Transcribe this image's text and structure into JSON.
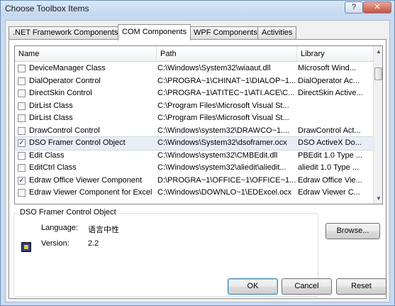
{
  "window": {
    "title": "Choose Toolbox Items",
    "help_label": "?",
    "close_label": "✕"
  },
  "tabs": [
    {
      "label": ".NET Framework Components",
      "active": false
    },
    {
      "label": "COM Components",
      "active": true
    },
    {
      "label": "WPF Components",
      "active": false
    },
    {
      "label": "Activities",
      "active": false
    }
  ],
  "list": {
    "columns": [
      "Name",
      "Path",
      "Library"
    ],
    "rows": [
      {
        "checked": false,
        "name": "DeviceManager Class",
        "path": "C:\\Windows\\System32\\wiaaut.dll",
        "library": "Microsoft Wind..."
      },
      {
        "checked": false,
        "name": "DialOperator Control",
        "path": "C:\\PROGRA~1\\CHINAT~1\\DIALOP~1...",
        "library": "DialOperator Ac..."
      },
      {
        "checked": false,
        "name": "DirectSkin Control",
        "path": "C:\\PROGRA~1\\ATITEC~1\\ATI.ACE\\C...",
        "library": "DirectSkin Active..."
      },
      {
        "checked": false,
        "name": "DirList Class",
        "path": "C:\\Program Files\\Microsoft Visual St...",
        "library": ""
      },
      {
        "checked": false,
        "name": "DirList Class",
        "path": "C:\\Program Files\\Microsoft Visual St...",
        "library": ""
      },
      {
        "checked": false,
        "name": "DrawControl Control",
        "path": "C:\\Windows\\system32\\DRAWCO~1....",
        "library": "DrawControl Act..."
      },
      {
        "checked": true,
        "name": "DSO Framer Control Object",
        "path": "C:\\Windows\\System32\\dsoframer.ocx",
        "library": "DSO ActiveX Do..."
      },
      {
        "checked": false,
        "name": "Edit Class",
        "path": "C:\\Windows\\system32\\CMBEdit.dll",
        "library": "PBEdit 1.0 Type ..."
      },
      {
        "checked": false,
        "name": "EditCtrl Class",
        "path": "C:\\Windows\\system32\\aliedit\\aliedit...",
        "library": "aliedit 1.0 Type ..."
      },
      {
        "checked": true,
        "name": "Edraw Office Viewer Component",
        "path": "D:\\PROGRA~1\\OFFICE~1\\OFFICE~1...",
        "library": "Edraw Office Vie..."
      },
      {
        "checked": false,
        "name": "Edraw Viewer Component for Excel",
        "path": "C:\\Windows\\DOWNLO~1\\EDExcel.ocx",
        "library": "Edraw Viewer C..."
      }
    ],
    "selected_index": 6
  },
  "details": {
    "title": "DSO Framer Control Object",
    "language_label": "Language:",
    "language_value": "语言中性",
    "version_label": "Version:",
    "version_value": "2.2"
  },
  "buttons": {
    "browse": "Browse...",
    "ok": "OK",
    "cancel": "Cancel",
    "reset": "Reset"
  }
}
